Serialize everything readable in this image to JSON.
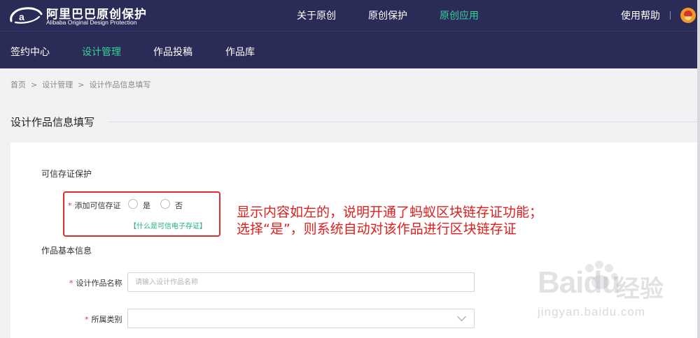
{
  "brand": {
    "title": "阿里巴巴原创保护",
    "subtitle": "Alibaba Original Design Protection"
  },
  "top_nav": [
    "关于原创",
    "原创保护",
    "原创应用"
  ],
  "top_nav_active": "原创应用",
  "help_label": "使用帮助",
  "sub_nav": [
    "签约中心",
    "设计管理",
    "作品投稿",
    "作品库"
  ],
  "sub_nav_active": "设计管理",
  "breadcrumb": [
    "首页",
    "设计管理",
    "设计作品信息填写"
  ],
  "breadcrumb_separator": ">",
  "page_title": "设计作品信息填写",
  "trust_section": {
    "heading": "可信存证保护",
    "field_label": "添加可信存证",
    "required_mark": "*",
    "options": [
      "是",
      "否"
    ],
    "help_link": "【什么是可信电子存证】"
  },
  "basic_section": {
    "heading": "作品基本信息",
    "name_label": "设计作品名称",
    "name_placeholder": "请输入设计作品名称",
    "category_label": "所属类别",
    "required_mark": "*"
  },
  "annotation": {
    "line1": "显示内容如左的，说明开通了蚂蚁区块链存证功能；",
    "line2": "选择“是”，则系统自动对该作品进行区块链存证"
  },
  "watermark": {
    "brand": "Baidu",
    "brand_cn": "经验",
    "url": "jingyan.baidu.com"
  },
  "colors": {
    "nav_bg": "#2b2b57",
    "nav_active": "#35d29a",
    "required": "#e83535",
    "annotation": "#e01e1e",
    "link": "#1fb07a"
  },
  "icons": [
    "alibaba-logo-icon",
    "user-avatar-icon",
    "radio-icon",
    "chevron-down-icon"
  ]
}
